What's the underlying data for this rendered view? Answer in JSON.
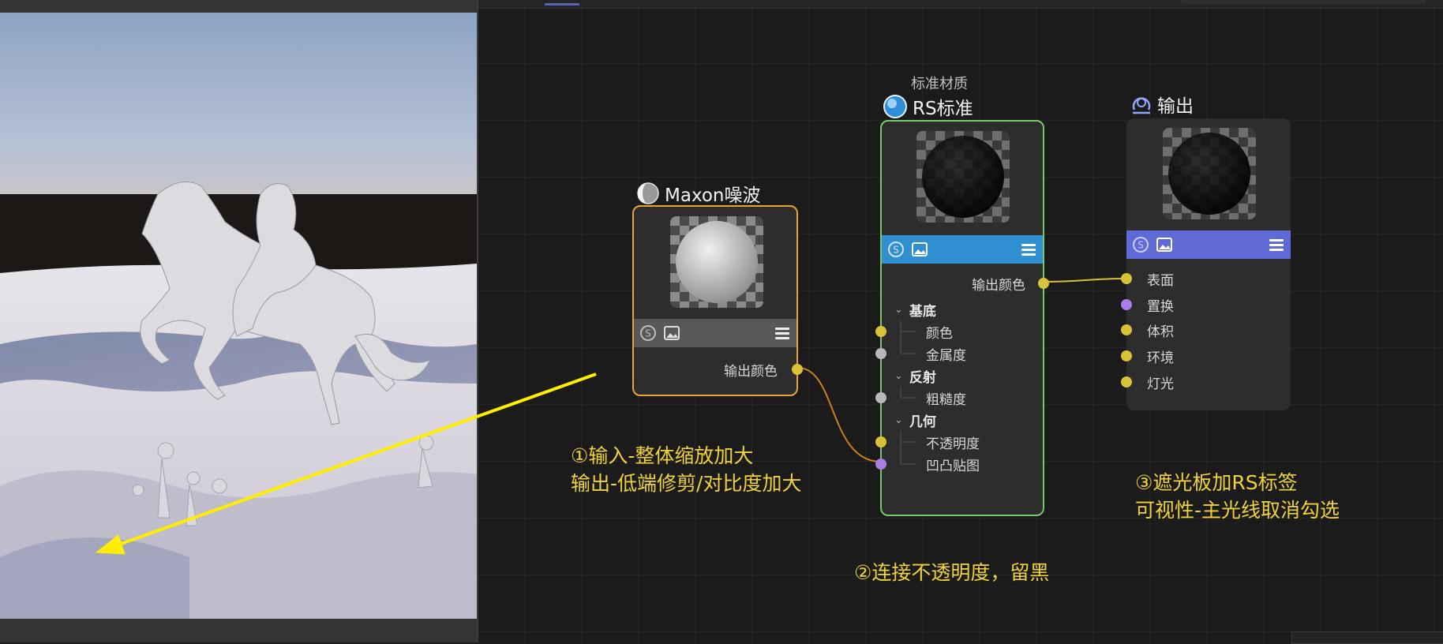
{
  "nodes": {
    "noise": {
      "title": "Maxon噪波",
      "output_port": "输出颜色"
    },
    "rs_standard": {
      "subtitle": "标准材质",
      "title": "RS标准",
      "output_port": "输出颜色",
      "groups": [
        {
          "label": "基底",
          "ports": [
            "颜色",
            "金属度"
          ]
        },
        {
          "label": "反射",
          "ports": [
            "粗糙度"
          ]
        },
        {
          "label": "几何",
          "ports": [
            "不透明度",
            "凹凸贴图"
          ]
        }
      ]
    },
    "output": {
      "title": "输出",
      "ports": [
        "表面",
        "置换",
        "体积",
        "环境",
        "灯光"
      ]
    }
  },
  "annotations": {
    "step1_line1": "①输入-整体缩放加大",
    "step1_line2": "输出-低端修剪/对比度加大",
    "step2": "②连接不透明度，留黑",
    "step3_line1": "③遮光板加RS标签",
    "step3_line2": "可视性-主光线取消勾选"
  },
  "colors": {
    "noise_border": "#e8a33c",
    "rs_border": "#78c96a",
    "rs_toolbar": "#2f8fd0",
    "output_toolbar": "#5f6ad6",
    "noise_toolbar": "#585858",
    "port_yellow": "#d8c23a",
    "port_gray": "#b8b8b8",
    "port_purple": "#a77de8",
    "wire_orange": "#c97f1c",
    "wire_yellow": "#d8c23a",
    "annotation": "#f0d23a",
    "arrow": "#ffee00"
  },
  "icons": [
    "noise-node-icon",
    "rs-standard-icon",
    "output-node-icon",
    "redshift-s-icon",
    "image-icon",
    "hamburger-menu-icon"
  ]
}
